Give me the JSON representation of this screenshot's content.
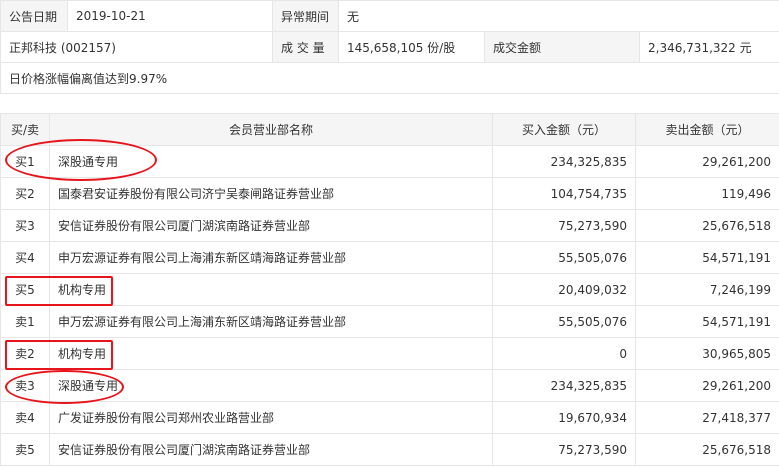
{
  "info": {
    "date_label": "公告日期",
    "date_value": "2019-10-21",
    "period_label": "异常期间",
    "period_value": "无",
    "stock": "正邦科技 (002157)",
    "volume_label": "成 交 量",
    "volume_value": "145,658,105 份/股",
    "amount_label": "成交金额",
    "amount_value": "2,346,731,322 元",
    "reason": "日价格涨幅偏离值达到9.97%"
  },
  "table": {
    "headers": [
      "买/卖",
      "会员营业部名称",
      "买入金额（元）",
      "卖出金额（元）"
    ],
    "rows": [
      {
        "side": "买1",
        "name": "深股通专用",
        "buy": "234,325,835",
        "sell": "29,261,200"
      },
      {
        "side": "买2",
        "name": "国泰君安证券股份有限公司济宁吴泰闸路证券营业部",
        "buy": "104,754,735",
        "sell": "119,496"
      },
      {
        "side": "买3",
        "name": "安信证券股份有限公司厦门湖滨南路证券营业部",
        "buy": "75,273,590",
        "sell": "25,676,518"
      },
      {
        "side": "买4",
        "name": "申万宏源证券有限公司上海浦东新区靖海路证券营业部",
        "buy": "55,505,076",
        "sell": "54,571,191"
      },
      {
        "side": "买5",
        "name": "机构专用",
        "buy": "20,409,032",
        "sell": "7,246,199"
      },
      {
        "side": "卖1",
        "name": "申万宏源证券有限公司上海浦东新区靖海路证券营业部",
        "buy": "55,505,076",
        "sell": "54,571,191"
      },
      {
        "side": "卖2",
        "name": "机构专用",
        "buy": "0",
        "sell": "30,965,805"
      },
      {
        "side": "卖3",
        "name": "深股通专用",
        "buy": "234,325,835",
        "sell": "29,261,200"
      },
      {
        "side": "卖4",
        "name": "广发证券股份有限公司郑州农业路营业部",
        "buy": "19,670,934",
        "sell": "27,418,377"
      },
      {
        "side": "卖5",
        "name": "安信证券股份有限公司厦门湖滨南路证券营业部",
        "buy": "75,273,590",
        "sell": "25,676,518"
      }
    ]
  },
  "highlight_color": "#e8141b"
}
